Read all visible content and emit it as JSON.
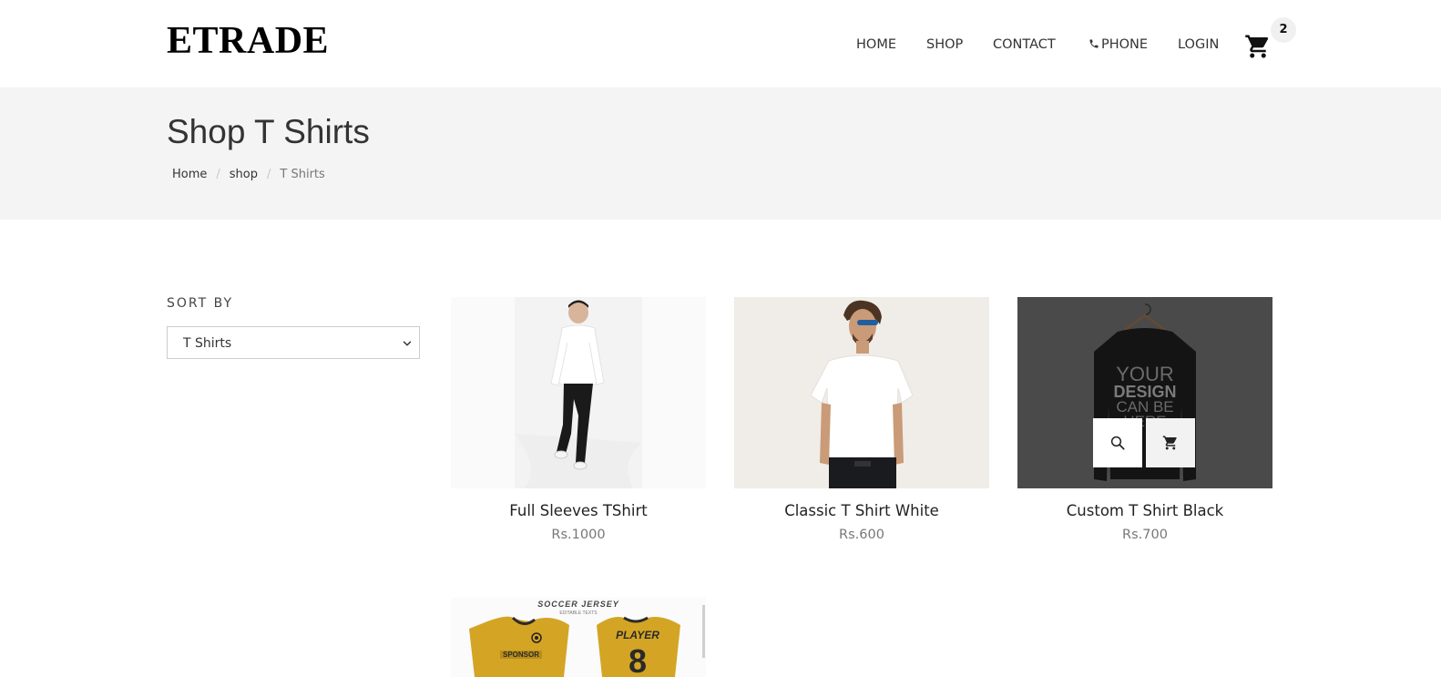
{
  "header": {
    "logo": "ETRADE",
    "nav": {
      "home": "HOME",
      "shop": "SHOP",
      "contact": "CONTACT",
      "phone": "PHONE",
      "login": "LOGIN"
    },
    "cart_count": "2",
    "icons": {
      "phone": "phone-icon",
      "cart": "cart-icon"
    }
  },
  "hero": {
    "title": "Shop T Shirts",
    "breadcrumb": [
      "Home",
      "shop",
      "T Shirts"
    ]
  },
  "sidebar": {
    "sort_label": "SORT BY",
    "sort_selected": "T Shirts"
  },
  "products": [
    {
      "name": "Full Sleeves TShirt",
      "price": "Rs.1000",
      "image": "man-white-longsleeve-photo"
    },
    {
      "name": "Classic T Shirt White",
      "price": "Rs.600",
      "image": "man-white-tshirt-photo"
    },
    {
      "name": "Custom T Shirt Black",
      "price": "Rs.700",
      "image": "black-sweatshirt-mockup"
    },
    {
      "name": "",
      "price": "",
      "image": "yellow-soccer-jersey",
      "image_text": {
        "title": "SOCCER JERSEY",
        "subtitle": "EDITABLE TEXTS",
        "sponsor": "SPONSOR",
        "player": "PLAYER",
        "number": "8",
        "mockup_lines": [
          "YOUR",
          "DESIGN",
          "CAN BE",
          "HERE"
        ]
      }
    }
  ],
  "colors": {
    "hero_bg": "#f4f4f4",
    "dark_card_bg": "#4a4a4a",
    "jersey_yellow": "#d4a524"
  }
}
